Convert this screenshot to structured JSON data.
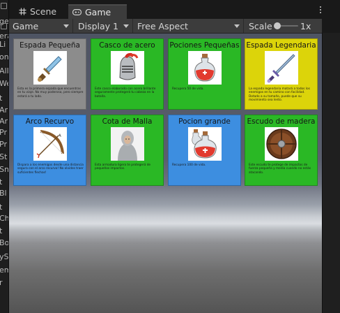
{
  "tabs": [
    {
      "label": "Scene",
      "icon": "grid-icon"
    },
    {
      "label": "Game",
      "icon": "gamepad-icon",
      "active": true
    }
  ],
  "toolbar": {
    "game_mode": "Game",
    "display": "Display 1",
    "aspect": "Free Aspect",
    "scale_label": "Scale",
    "scale_value": "1x"
  },
  "left_fragments": [
    "ge",
    "era",
    "Li",
    "on",
    "All",
    "We",
    "t",
    "Ar",
    "Ar",
    "Pr",
    "Pr",
    "St",
    "Sn",
    "t",
    "Bl",
    "t",
    "Ch",
    "t",
    "Bo",
    "yS",
    "em",
    "r"
  ],
  "colors": {
    "gray": "#8c8c8c",
    "green": "#2ab825",
    "yellow": "#dcd40a",
    "blue": "#3d8ee0"
  },
  "cards": [
    {
      "title": "Espada Pequeña",
      "bg": "gray",
      "icon": "small-sword-icon",
      "desc": "Esta es la primera espada que encuentras en tu viaje. No muy poderosa, pero siempre estará a tu lado."
    },
    {
      "title": "Casco de acero",
      "bg": "green",
      "icon": "steel-helmet-icon",
      "desc": "Este casco elaborado con acero brillante seguramente protegerá tu cabeza en la batalla."
    },
    {
      "title": "Pociones Pequeñas",
      "bg": "green",
      "icon": "potion-icon",
      "desc": "Recupera 50 de vida."
    },
    {
      "title": "Espada Legendaria",
      "bg": "yellow",
      "icon": "legendary-sword-icon",
      "desc": "La espada legendaria matará a todos los enemigos en tu camino con facilidad. Dotado a su tamaño, puede que su movimiento sea lento."
    },
    {
      "title": "Arco Recurvo",
      "bg": "blue",
      "icon": "bow-icon",
      "desc": "Dispara a los enemigos desde una distancia segura con el arco recurvo! No olvides traer suficientes flechas!"
    },
    {
      "title": "Cota de Malla",
      "bg": "green",
      "icon": "chainmail-icon",
      "desc": "Esta armadura ligera te protegerá de pequeños impactos."
    },
    {
      "title": "Pocion grande",
      "bg": "blue",
      "icon": "large-potion-icon",
      "desc": "Recupera 100 de vida."
    },
    {
      "title": "Escudo de madera",
      "bg": "green",
      "icon": "wooden-shield-icon",
      "desc": "Este escudo te protege de impactos de fuerza pequeña y media cuando no estás atacando."
    }
  ]
}
